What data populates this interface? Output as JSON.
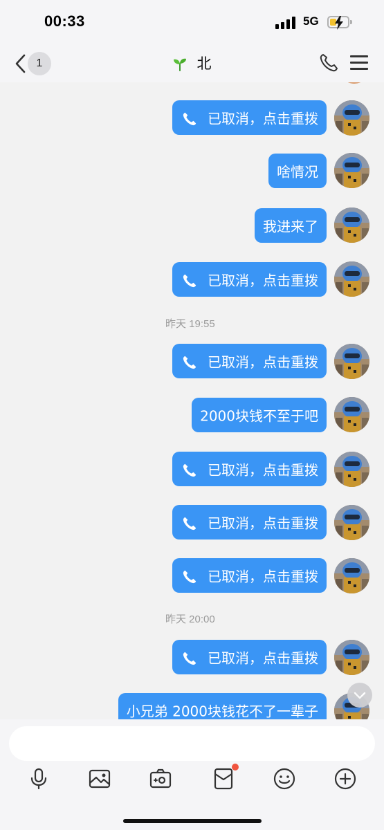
{
  "status_bar": {
    "time": "00:33",
    "network": "5G"
  },
  "header": {
    "unread_count": "1",
    "title": "北"
  },
  "messages": [
    {
      "type": "call",
      "text": "已取消，点击重拨"
    },
    {
      "type": "text",
      "text": "啥情况"
    },
    {
      "type": "text",
      "text": "我进来了"
    },
    {
      "type": "call",
      "text": "已取消，点击重拨"
    },
    {
      "type": "time",
      "text": "昨天 19:55"
    },
    {
      "type": "call",
      "text": "已取消，点击重拨"
    },
    {
      "type": "text",
      "text": "2000块钱不至于吧"
    },
    {
      "type": "call",
      "text": "已取消，点击重拨"
    },
    {
      "type": "call",
      "text": "已取消，点击重拨"
    },
    {
      "type": "call",
      "text": "已取消，点击重拨"
    },
    {
      "type": "time",
      "text": "昨天 20:00"
    },
    {
      "type": "call",
      "text": "已取消，点击重拨"
    },
    {
      "type": "text",
      "text": "小兄弟 2000块钱花不了一辈子"
    }
  ],
  "composer": {
    "input_value": "",
    "tools": [
      "microphone-icon",
      "image-icon",
      "camera-icon",
      "red-packet-icon",
      "emoji-icon",
      "plus-icon"
    ]
  },
  "colors": {
    "bubble": "#3a95f5",
    "background": "#f2f2f2",
    "badge_dot": "#f0543f"
  }
}
